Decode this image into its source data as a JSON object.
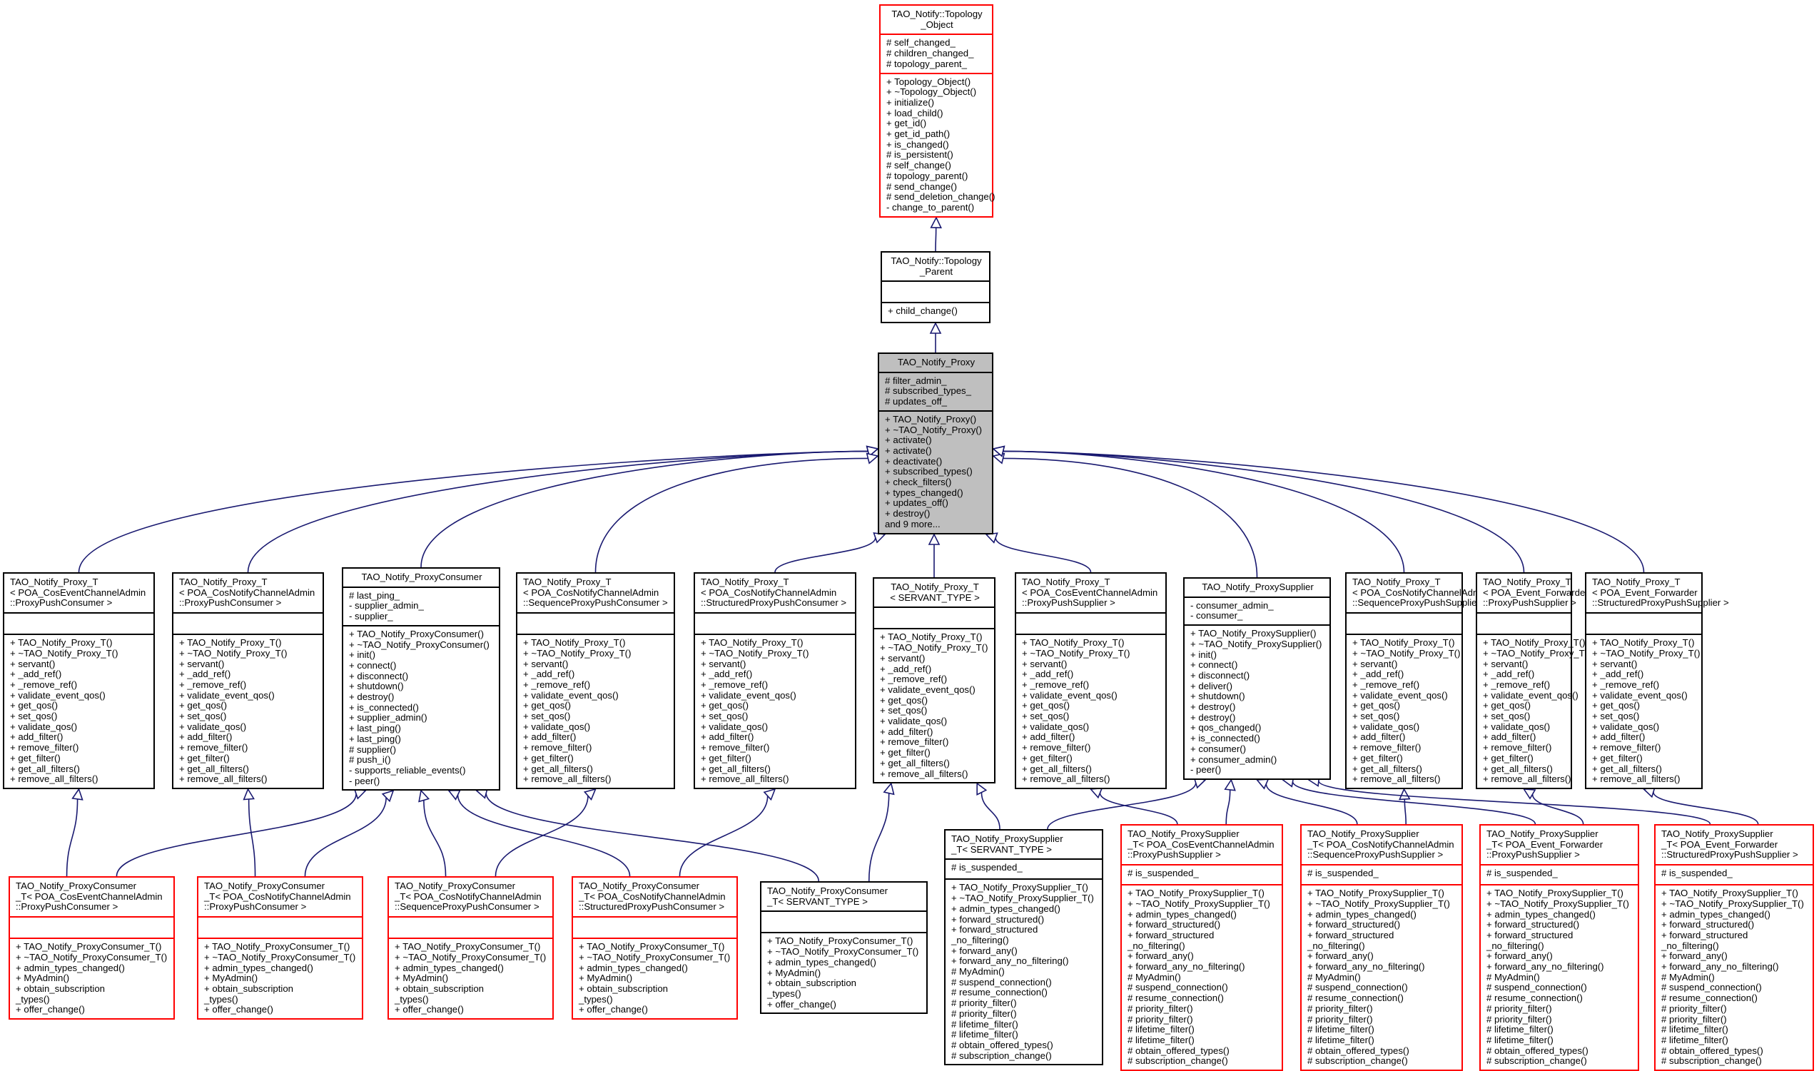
{
  "diagram": {
    "type": "UML class inheritance diagram",
    "edge_color": "#191970",
    "highlight_fill": "#bfbfbf",
    "incomplete_border_color": "#ff0000",
    "classes": [
      {
        "id": "topology_object",
        "title": "TAO_Notify::Topology\n_Object",
        "border": "red",
        "attributes": [
          "# self_changed_",
          "# children_changed_",
          "# topology_parent_"
        ],
        "methods": [
          "+ Topology_Object()",
          "+ ~Topology_Object()",
          "+ initialize()",
          "+ load_child()",
          "+ get_id()",
          "+ get_id_path()",
          "+ is_changed()",
          "# is_persistent()",
          "# self_change()",
          "# topology_parent()",
          "# send_change()",
          "# send_deletion_change()",
          "- change_to_parent()"
        ]
      },
      {
        "id": "topology_parent",
        "title": "TAO_Notify::Topology\n_Parent",
        "border": "black",
        "attributes": [],
        "methods": [
          "+ child_change()"
        ]
      },
      {
        "id": "notify_proxy",
        "title": "TAO_Notify_Proxy",
        "border": "black",
        "highlighted": true,
        "attributes": [
          "# filter_admin_",
          "# subscribed_types_",
          "# updates_off_"
        ],
        "methods": [
          "+ TAO_Notify_Proxy()",
          "+ ~TAO_Notify_Proxy()",
          "+ activate()",
          "+ activate()",
          "+ deactivate()",
          "+ subscribed_types()",
          "+ check_filters()",
          "+ types_changed()",
          "+ updates_off()",
          "+ destroy()",
          "and 9 more..."
        ]
      },
      {
        "id": "proxy_t_cosevent_ppc",
        "title": "TAO_Notify_Proxy_T\n< POA_CosEventChannelAdmin\n::ProxyPushConsumer >",
        "border": "black",
        "attributes": [],
        "methods": [
          "+ TAO_Notify_Proxy_T()",
          "+ ~TAO_Notify_Proxy_T()",
          "+ servant()",
          "+ _add_ref()",
          "+ _remove_ref()",
          "+ validate_event_qos()",
          "+ get_qos()",
          "+ set_qos()",
          "+ validate_qos()",
          "+ add_filter()",
          "+ remove_filter()",
          "+ get_filter()",
          "+ get_all_filters()",
          "+ remove_all_filters()"
        ]
      },
      {
        "id": "proxy_t_cosnotify_ppc",
        "title": "TAO_Notify_Proxy_T\n< POA_CosNotifyChannelAdmin\n::ProxyPushConsumer >",
        "border": "black",
        "attributes": [],
        "methods": [
          "+ TAO_Notify_Proxy_T()",
          "+ ~TAO_Notify_Proxy_T()",
          "+ servant()",
          "+ _add_ref()",
          "+ _remove_ref()",
          "+ validate_event_qos()",
          "+ get_qos()",
          "+ set_qos()",
          "+ validate_qos()",
          "+ add_filter()",
          "+ remove_filter()",
          "+ get_filter()",
          "+ get_all_filters()",
          "+ remove_all_filters()"
        ]
      },
      {
        "id": "proxy_consumer",
        "title": "TAO_Notify_ProxyConsumer",
        "border": "black",
        "attributes": [
          "# last_ping_",
          "- supplier_admin_",
          "- supplier_"
        ],
        "methods": [
          "+ TAO_Notify_ProxyConsumer()",
          "+ ~TAO_Notify_ProxyConsumer()",
          "+ init()",
          "+ connect()",
          "+ disconnect()",
          "+ shutdown()",
          "+ destroy()",
          "+ is_connected()",
          "+ supplier_admin()",
          "+ last_ping()",
          "+ last_ping()",
          "# supplier()",
          "# push_i()",
          "- supports_reliable_events()",
          "- peer()"
        ]
      },
      {
        "id": "proxy_t_cosnotify_sppc",
        "title": "TAO_Notify_Proxy_T\n< POA_CosNotifyChannelAdmin\n::SequenceProxyPushConsumer >",
        "border": "black",
        "attributes": [],
        "methods": [
          "+ TAO_Notify_Proxy_T()",
          "+ ~TAO_Notify_Proxy_T()",
          "+ servant()",
          "+ _add_ref()",
          "+ _remove_ref()",
          "+ validate_event_qos()",
          "+ get_qos()",
          "+ set_qos()",
          "+ validate_qos()",
          "+ add_filter()",
          "+ remove_filter()",
          "+ get_filter()",
          "+ get_all_filters()",
          "+ remove_all_filters()"
        ]
      },
      {
        "id": "proxy_t_cosnotify_stppc",
        "title": "TAO_Notify_Proxy_T\n< POA_CosNotifyChannelAdmin\n::StructuredProxyPushConsumer >",
        "border": "black",
        "attributes": [],
        "methods": [
          "+ TAO_Notify_Proxy_T()",
          "+ ~TAO_Notify_Proxy_T()",
          "+ servant()",
          "+ _add_ref()",
          "+ _remove_ref()",
          "+ validate_event_qos()",
          "+ get_qos()",
          "+ set_qos()",
          "+ validate_qos()",
          "+ add_filter()",
          "+ remove_filter()",
          "+ get_filter()",
          "+ get_all_filters()",
          "+ remove_all_filters()"
        ]
      },
      {
        "id": "proxy_t_servant",
        "title": "TAO_Notify_Proxy_T\n< SERVANT_TYPE >",
        "border": "black",
        "attributes": [],
        "methods": [
          "+ TAO_Notify_Proxy_T()",
          "+ ~TAO_Notify_Proxy_T()",
          "+ servant()",
          "+ _add_ref()",
          "+ _remove_ref()",
          "+ validate_event_qos()",
          "+ get_qos()",
          "+ set_qos()",
          "+ validate_qos()",
          "+ add_filter()",
          "+ remove_filter()",
          "+ get_filter()",
          "+ get_all_filters()",
          "+ remove_all_filters()"
        ]
      },
      {
        "id": "proxy_t_cosevent_pps",
        "title": "TAO_Notify_Proxy_T\n< POA_CosEventChannelAdmin\n::ProxyPushSupplier >",
        "border": "black",
        "attributes": [],
        "methods": [
          "+ TAO_Notify_Proxy_T()",
          "+ ~TAO_Notify_Proxy_T()",
          "+ servant()",
          "+ _add_ref()",
          "+ _remove_ref()",
          "+ validate_event_qos()",
          "+ get_qos()",
          "+ set_qos()",
          "+ validate_qos()",
          "+ add_filter()",
          "+ remove_filter()",
          "+ get_filter()",
          "+ get_all_filters()",
          "+ remove_all_filters()"
        ]
      },
      {
        "id": "proxy_supplier",
        "title": "TAO_Notify_ProxySupplier",
        "border": "black",
        "attributes": [
          "- consumer_admin_",
          "- consumer_"
        ],
        "methods": [
          "+ TAO_Notify_ProxySupplier()",
          "+ ~TAO_Notify_ProxySupplier()",
          "+ init()",
          "+ connect()",
          "+ disconnect()",
          "+ deliver()",
          "+ shutdown()",
          "+ destroy()",
          "+ destroy()",
          "+ qos_changed()",
          "+ is_connected()",
          "+ consumer()",
          "+ consumer_admin()",
          "- peer()"
        ]
      },
      {
        "id": "proxy_t_cosnotify_spps",
        "title": "TAO_Notify_Proxy_T\n< POA_CosNotifyChannelAdmin\n::SequenceProxyPushSupplier >",
        "border": "black",
        "attributes": [],
        "methods": [
          "+ TAO_Notify_Proxy_T()",
          "+ ~TAO_Notify_Proxy_T()",
          "+ servant()",
          "+ _add_ref()",
          "+ _remove_ref()",
          "+ validate_event_qos()",
          "+ get_qos()",
          "+ set_qos()",
          "+ validate_qos()",
          "+ add_filter()",
          "+ remove_filter()",
          "+ get_filter()",
          "+ get_all_filters()",
          "+ remove_all_filters()"
        ]
      },
      {
        "id": "proxy_t_eventfwd_pps",
        "title": "TAO_Notify_Proxy_T\n< POA_Event_Forwarder\n::ProxyPushSupplier >",
        "border": "black",
        "attributes": [],
        "methods": [
          "+ TAO_Notify_Proxy_T()",
          "+ ~TAO_Notify_Proxy_T()",
          "+ servant()",
          "+ _add_ref()",
          "+ _remove_ref()",
          "+ validate_event_qos()",
          "+ get_qos()",
          "+ set_qos()",
          "+ validate_qos()",
          "+ add_filter()",
          "+ remove_filter()",
          "+ get_filter()",
          "+ get_all_filters()",
          "+ remove_all_filters()"
        ]
      },
      {
        "id": "proxy_t_eventfwd_stpps",
        "title": "TAO_Notify_Proxy_T\n< POA_Event_Forwarder\n::StructuredProxyPushSupplier >",
        "border": "black",
        "attributes": [],
        "methods": [
          "+ TAO_Notify_Proxy_T()",
          "+ ~TAO_Notify_Proxy_T()",
          "+ servant()",
          "+ _add_ref()",
          "+ _remove_ref()",
          "+ validate_event_qos()",
          "+ get_qos()",
          "+ set_qos()",
          "+ validate_qos()",
          "+ add_filter()",
          "+ remove_filter()",
          "+ get_filter()",
          "+ get_all_filters()",
          "+ remove_all_filters()"
        ]
      },
      {
        "id": "pc_t_cosevent_ppc",
        "title": "TAO_Notify_ProxyConsumer\n_T< POA_CosEventChannelAdmin\n::ProxyPushConsumer >",
        "border": "red",
        "attributes": [],
        "methods": [
          "+ TAO_Notify_ProxyConsumer_T()",
          "+ ~TAO_Notify_ProxyConsumer_T()",
          "+ admin_types_changed()",
          "+ MyAdmin()",
          "+ obtain_subscription\n_types()",
          "+ offer_change()"
        ]
      },
      {
        "id": "pc_t_cosnotify_ppc",
        "title": "TAO_Notify_ProxyConsumer\n_T< POA_CosNotifyChannelAdmin\n::ProxyPushConsumer >",
        "border": "red",
        "attributes": [],
        "methods": [
          "+ TAO_Notify_ProxyConsumer_T()",
          "+ ~TAO_Notify_ProxyConsumer_T()",
          "+ admin_types_changed()",
          "+ MyAdmin()",
          "+ obtain_subscription\n_types()",
          "+ offer_change()"
        ]
      },
      {
        "id": "pc_t_cosnotify_sppc",
        "title": "TAO_Notify_ProxyConsumer\n_T< POA_CosNotifyChannelAdmin\n::SequenceProxyPushConsumer >",
        "border": "red",
        "attributes": [],
        "methods": [
          "+ TAO_Notify_ProxyConsumer_T()",
          "+ ~TAO_Notify_ProxyConsumer_T()",
          "+ admin_types_changed()",
          "+ MyAdmin()",
          "+ obtain_subscription\n_types()",
          "+ offer_change()"
        ]
      },
      {
        "id": "pc_t_cosnotify_stppc",
        "title": "TAO_Notify_ProxyConsumer\n_T< POA_CosNotifyChannelAdmin\n::StructuredProxyPushConsumer >",
        "border": "red",
        "attributes": [],
        "methods": [
          "+ TAO_Notify_ProxyConsumer_T()",
          "+ ~TAO_Notify_ProxyConsumer_T()",
          "+ admin_types_changed()",
          "+ MyAdmin()",
          "+ obtain_subscription\n_types()",
          "+ offer_change()"
        ]
      },
      {
        "id": "pc_t_servant",
        "title": "TAO_Notify_ProxyConsumer\n_T< SERVANT_TYPE >",
        "border": "black",
        "attributes": [],
        "methods": [
          "+ TAO_Notify_ProxyConsumer_T()",
          "+ ~TAO_Notify_ProxyConsumer_T()",
          "+ admin_types_changed()",
          "+ MyAdmin()",
          "+ obtain_subscription\n_types()",
          "+ offer_change()"
        ]
      },
      {
        "id": "ps_t_servant",
        "title": "TAO_Notify_ProxySupplier\n_T< SERVANT_TYPE >",
        "border": "black",
        "attributes": [
          "# is_suspended_"
        ],
        "methods": [
          "+ TAO_Notify_ProxySupplier_T()",
          "+ ~TAO_Notify_ProxySupplier_T()",
          "+ admin_types_changed()",
          "+ forward_structured()",
          "+ forward_structured\n_no_filtering()",
          "+ forward_any()",
          "+ forward_any_no_filtering()",
          "# MyAdmin()",
          "# suspend_connection()",
          "# resume_connection()",
          "# priority_filter()",
          "# priority_filter()",
          "# lifetime_filter()",
          "# lifetime_filter()",
          "# obtain_offered_types()",
          "# subscription_change()"
        ]
      },
      {
        "id": "ps_t_cosevent_pps",
        "title": "TAO_Notify_ProxySupplier\n_T< POA_CosEventChannelAdmin\n::ProxyPushSupplier >",
        "border": "red",
        "attributes": [
          "# is_suspended_"
        ],
        "methods": [
          "+ TAO_Notify_ProxySupplier_T()",
          "+ ~TAO_Notify_ProxySupplier_T()",
          "+ admin_types_changed()",
          "+ forward_structured()",
          "+ forward_structured\n_no_filtering()",
          "+ forward_any()",
          "+ forward_any_no_filtering()",
          "# MyAdmin()",
          "# suspend_connection()",
          "# resume_connection()",
          "# priority_filter()",
          "# priority_filter()",
          "# lifetime_filter()",
          "# lifetime_filter()",
          "# obtain_offered_types()",
          "# subscription_change()"
        ]
      },
      {
        "id": "ps_t_cosnotify_spps",
        "title": "TAO_Notify_ProxySupplier\n_T< POA_CosNotifyChannelAdmin\n::SequenceProxyPushSupplier >",
        "border": "red",
        "attributes": [
          "# is_suspended_"
        ],
        "methods": [
          "+ TAO_Notify_ProxySupplier_T()",
          "+ ~TAO_Notify_ProxySupplier_T()",
          "+ admin_types_changed()",
          "+ forward_structured()",
          "+ forward_structured\n_no_filtering()",
          "+ forward_any()",
          "+ forward_any_no_filtering()",
          "# MyAdmin()",
          "# suspend_connection()",
          "# resume_connection()",
          "# priority_filter()",
          "# priority_filter()",
          "# lifetime_filter()",
          "# lifetime_filter()",
          "# obtain_offered_types()",
          "# subscription_change()"
        ]
      },
      {
        "id": "ps_t_eventfwd_pps",
        "title": "TAO_Notify_ProxySupplier\n_T< POA_Event_Forwarder\n::ProxyPushSupplier >",
        "border": "red",
        "attributes": [
          "# is_suspended_"
        ],
        "methods": [
          "+ TAO_Notify_ProxySupplier_T()",
          "+ ~TAO_Notify_ProxySupplier_T()",
          "+ admin_types_changed()",
          "+ forward_structured()",
          "+ forward_structured\n_no_filtering()",
          "+ forward_any()",
          "+ forward_any_no_filtering()",
          "# MyAdmin()",
          "# suspend_connection()",
          "# resume_connection()",
          "# priority_filter()",
          "# priority_filter()",
          "# lifetime_filter()",
          "# lifetime_filter()",
          "# obtain_offered_types()",
          "# subscription_change()"
        ]
      },
      {
        "id": "ps_t_eventfwd_stpps",
        "title": "TAO_Notify_ProxySupplier\n_T< POA_Event_Forwarder\n::StructuredProxyPushSupplier >",
        "border": "red",
        "attributes": [
          "# is_suspended_"
        ],
        "methods": [
          "+ TAO_Notify_ProxySupplier_T()",
          "+ ~TAO_Notify_ProxySupplier_T()",
          "+ admin_types_changed()",
          "+ forward_structured()",
          "+ forward_structured\n_no_filtering()",
          "+ forward_any()",
          "+ forward_any_no_filtering()",
          "# MyAdmin()",
          "# suspend_connection()",
          "# resume_connection()",
          "# priority_filter()",
          "# priority_filter()",
          "# lifetime_filter()",
          "# lifetime_filter()",
          "# obtain_offered_types()",
          "# subscription_change()"
        ]
      }
    ],
    "inheritance": [
      {
        "child": "topology_parent",
        "parent": "topology_object"
      },
      {
        "child": "notify_proxy",
        "parent": "topology_parent"
      },
      {
        "child": "proxy_t_cosevent_ppc",
        "parent": "notify_proxy"
      },
      {
        "child": "proxy_t_cosnotify_ppc",
        "parent": "notify_proxy"
      },
      {
        "child": "proxy_consumer",
        "parent": "notify_proxy"
      },
      {
        "child": "proxy_t_cosnotify_sppc",
        "parent": "notify_proxy"
      },
      {
        "child": "proxy_t_cosnotify_stppc",
        "parent": "notify_proxy"
      },
      {
        "child": "proxy_t_servant",
        "parent": "notify_proxy"
      },
      {
        "child": "proxy_t_cosevent_pps",
        "parent": "notify_proxy"
      },
      {
        "child": "proxy_supplier",
        "parent": "notify_proxy"
      },
      {
        "child": "proxy_t_cosnotify_spps",
        "parent": "notify_proxy"
      },
      {
        "child": "proxy_t_eventfwd_pps",
        "parent": "notify_proxy"
      },
      {
        "child": "proxy_t_eventfwd_stpps",
        "parent": "notify_proxy"
      },
      {
        "child": "pc_t_cosevent_ppc",
        "parent": "proxy_t_cosevent_ppc"
      },
      {
        "child": "pc_t_cosevent_ppc",
        "parent": "proxy_consumer"
      },
      {
        "child": "pc_t_cosnotify_ppc",
        "parent": "proxy_t_cosnotify_ppc"
      },
      {
        "child": "pc_t_cosnotify_ppc",
        "parent": "proxy_consumer"
      },
      {
        "child": "pc_t_cosnotify_sppc",
        "parent": "proxy_consumer"
      },
      {
        "child": "pc_t_cosnotify_sppc",
        "parent": "proxy_t_cosnotify_sppc"
      },
      {
        "child": "pc_t_cosnotify_stppc",
        "parent": "proxy_consumer"
      },
      {
        "child": "pc_t_cosnotify_stppc",
        "parent": "proxy_t_cosnotify_stppc"
      },
      {
        "child": "pc_t_servant",
        "parent": "proxy_consumer"
      },
      {
        "child": "pc_t_servant",
        "parent": "proxy_t_servant"
      },
      {
        "child": "ps_t_servant",
        "parent": "proxy_t_servant"
      },
      {
        "child": "ps_t_servant",
        "parent": "proxy_supplier"
      },
      {
        "child": "ps_t_cosevent_pps",
        "parent": "proxy_t_cosevent_pps"
      },
      {
        "child": "ps_t_cosevent_pps",
        "parent": "proxy_supplier"
      },
      {
        "child": "ps_t_cosnotify_spps",
        "parent": "proxy_supplier"
      },
      {
        "child": "ps_t_cosnotify_spps",
        "parent": "proxy_t_cosnotify_spps"
      },
      {
        "child": "ps_t_eventfwd_pps",
        "parent": "proxy_supplier"
      },
      {
        "child": "ps_t_eventfwd_pps",
        "parent": "proxy_t_eventfwd_pps"
      },
      {
        "child": "ps_t_eventfwd_stpps",
        "parent": "proxy_supplier"
      },
      {
        "child": "ps_t_eventfwd_stpps",
        "parent": "proxy_t_eventfwd_stpps"
      }
    ]
  }
}
